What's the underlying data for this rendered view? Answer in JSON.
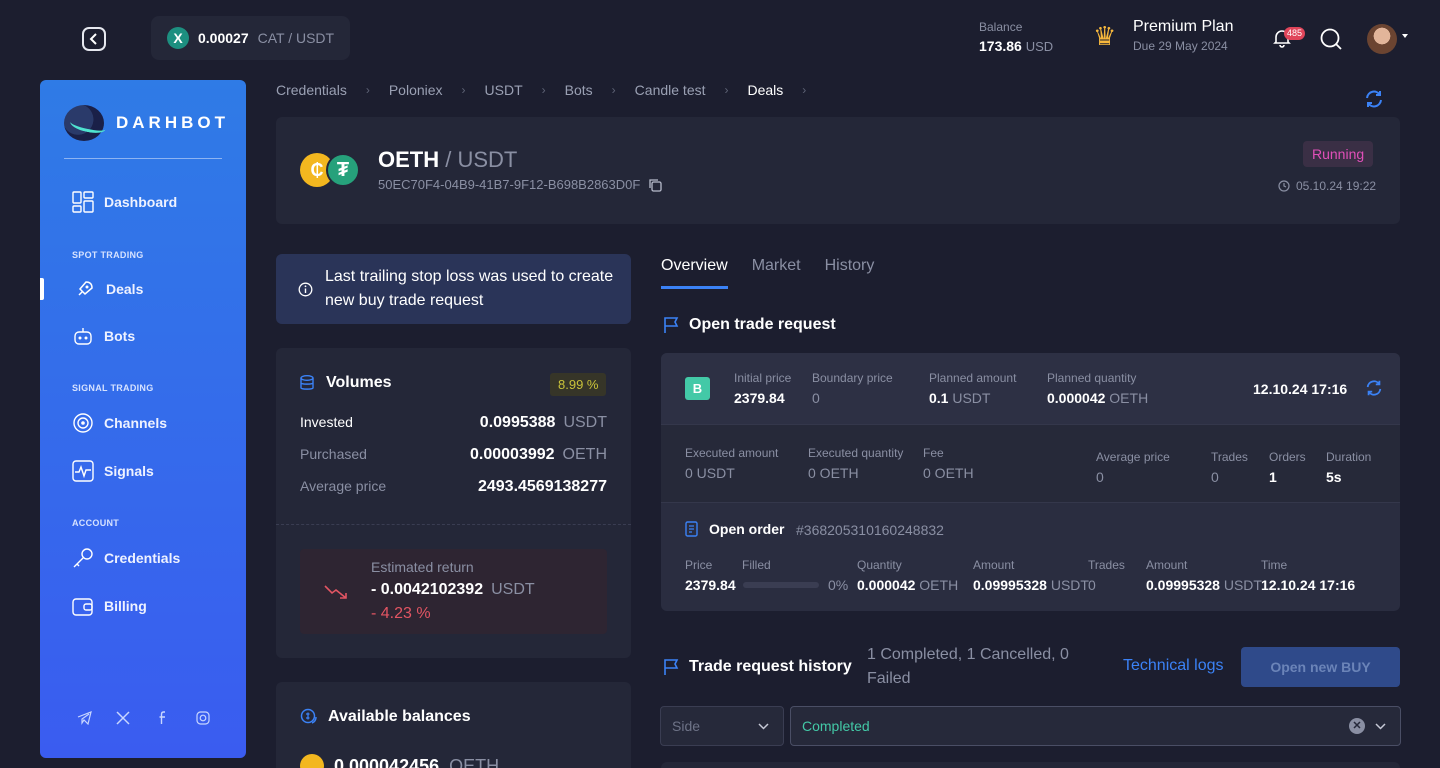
{
  "ticker": {
    "price": "0.00027",
    "pair": "CAT / USDT",
    "icon_letter": "X"
  },
  "balance": {
    "label": "Balance",
    "value": "173.86",
    "currency": "USD"
  },
  "plan": {
    "name": "Premium Plan",
    "due": "Due 29 May 2024"
  },
  "notifications": {
    "count": "485"
  },
  "sidebar": {
    "logo": "DARHBOT",
    "dashboard": "Dashboard",
    "section_spot": "SPOT TRADING",
    "deals": "Deals",
    "bots": "Bots",
    "section_signal": "SIGNAL TRADING",
    "channels": "Channels",
    "signals": "Signals",
    "section_account": "ACCOUNT",
    "credentials": "Credentials",
    "billing": "Billing"
  },
  "breadcrumb": [
    "Credentials",
    "Poloniex",
    "USDT",
    "Bots",
    "Candle test",
    "Deals"
  ],
  "deal": {
    "base": "OETH",
    "quote": "/ USDT",
    "id": "50EC70F4-04B9-41B7-9F12-B698B2863D0F",
    "status": "Running",
    "created": "05.10.24 19:22"
  },
  "info": "Last trailing stop loss was used to create new buy trade request",
  "volumes": {
    "title": "Volumes",
    "pct": "8.99 %",
    "invested_label": "Invested",
    "invested": "0.0995388",
    "invested_unit": "USDT",
    "purchased_label": "Purchased",
    "purchased": "0.00003992",
    "purchased_unit": "OETH",
    "avg_label": "Average price",
    "avg": "2493.4569138277",
    "est_label": "Estimated return",
    "est_value": "- 0.0042102392",
    "est_unit": "USDT",
    "est_pct": "- 4.23 %"
  },
  "balances": {
    "title": "Available balances",
    "value": "0.000042456",
    "unit": "OETH"
  },
  "tabs": [
    "Overview",
    "Market",
    "History"
  ],
  "otr": {
    "title": "Open trade request",
    "side": "B",
    "initial_price_label": "Initial price",
    "initial_price": "2379.84",
    "boundary_price_label": "Boundary price",
    "boundary_price": "0",
    "planned_amount_label": "Planned amount",
    "planned_amount": "0.1",
    "planned_amount_unit": "USDT",
    "planned_qty_label": "Planned quantity",
    "planned_qty": "0.000042",
    "planned_qty_unit": "OETH",
    "time": "12.10.24 17:16",
    "exec_amount_label": "Executed amount",
    "exec_amount": "0 USDT",
    "exec_qty_label": "Executed quantity",
    "exec_qty": "0 OETH",
    "fee_label": "Fee",
    "fee": "0 OETH",
    "avg_price_label": "Average price",
    "avg_price": "0",
    "trades_label": "Trades",
    "trades": "0",
    "orders_label": "Orders",
    "orders": "1",
    "duration_label": "Duration",
    "duration": "5s"
  },
  "open_order": {
    "title": "Open order",
    "id": "#368205310160248832",
    "price_label": "Price",
    "price": "2379.84",
    "filled_label": "Filled",
    "filled_pct": "0%",
    "filled_fraction": 0,
    "qty_label": "Quantity",
    "qty": "0.000042",
    "qty_unit": "OETH",
    "amount_label": "Amount",
    "amount": "0.09995328",
    "amount_unit": "USDT",
    "trades_label": "Trades",
    "trades": "0",
    "amount2_label": "Amount",
    "amount2": "0.09995328",
    "amount2_unit": "USDT",
    "time_label": "Time",
    "time": "12.10.24 17:16"
  },
  "history": {
    "title": "Trade request history",
    "summary": "1 Completed, 1 Cancelled, 0 Failed",
    "tech_logs": "Technical logs",
    "open_buy": "Open new BUY",
    "side_placeholder": "Side",
    "status_value": "Completed"
  },
  "colors": {
    "accent": "#3b82f6",
    "running": "#e04fb8",
    "buy": "#43c9a7",
    "negative": "#e25563"
  }
}
